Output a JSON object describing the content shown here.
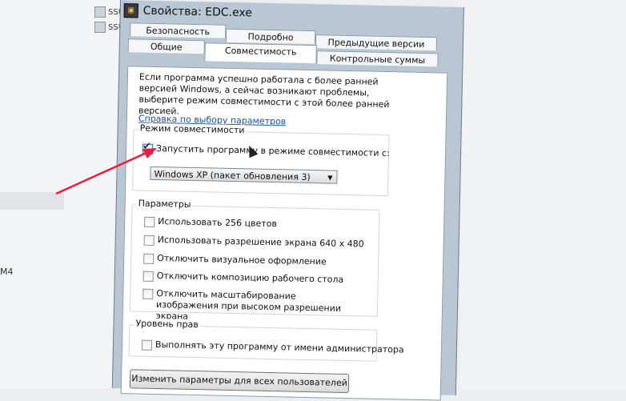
{
  "background": {
    "files": [
      "SSU",
      "SSU"
    ],
    "side_label": "M4"
  },
  "dialog": {
    "title": "Свойства: EDC.exe",
    "tabs_row1": [
      "Безопасность",
      "Подробно",
      "Предыдущие версии"
    ],
    "tabs_row2": [
      "Общие",
      "Совместимость",
      "Контрольные суммы"
    ],
    "active_tab": "Совместимость",
    "description": "Если программа успешно работала с более ранней версией Windows, а сейчас возникают проблемы, выберите режим совместимости с этой более ранней версией.",
    "help_link": "Справка по выбору параметров",
    "compat_group": {
      "label": "Режим совместимости",
      "checkbox_label": "Запустить программу в режиме совместимости с:",
      "checked": true,
      "selected_os": "Windows XP (пакет обновления 3)"
    },
    "params_group": {
      "label": "Параметры",
      "options": [
        "Использовать 256 цветов",
        "Использовать разрешение экрана 640 x 480",
        "Отключить визуальное оформление",
        "Отключить композицию рабочего стола",
        "Отключить масштабирование изображения при высоком разрешении экрана"
      ]
    },
    "rights_group": {
      "label": "Уровень прав",
      "option": "Выполнять эту программу от имени администратора"
    },
    "all_users_button": "Изменить параметры для всех пользователей"
  },
  "colors": {
    "annotation_arrow": "#ee1c3c",
    "link": "#1a4fb8"
  }
}
